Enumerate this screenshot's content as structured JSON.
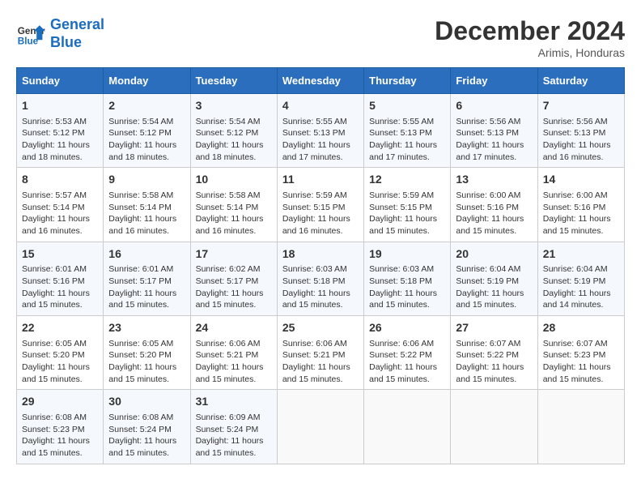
{
  "header": {
    "logo_line1": "General",
    "logo_line2": "Blue",
    "month": "December 2024",
    "location": "Arimis, Honduras"
  },
  "days_of_week": [
    "Sunday",
    "Monday",
    "Tuesday",
    "Wednesday",
    "Thursday",
    "Friday",
    "Saturday"
  ],
  "weeks": [
    [
      {
        "day": "1",
        "sunrise": "Sunrise: 5:53 AM",
        "sunset": "Sunset: 5:12 PM",
        "daylight": "Daylight: 11 hours and 18 minutes."
      },
      {
        "day": "2",
        "sunrise": "Sunrise: 5:54 AM",
        "sunset": "Sunset: 5:12 PM",
        "daylight": "Daylight: 11 hours and 18 minutes."
      },
      {
        "day": "3",
        "sunrise": "Sunrise: 5:54 AM",
        "sunset": "Sunset: 5:12 PM",
        "daylight": "Daylight: 11 hours and 18 minutes."
      },
      {
        "day": "4",
        "sunrise": "Sunrise: 5:55 AM",
        "sunset": "Sunset: 5:13 PM",
        "daylight": "Daylight: 11 hours and 17 minutes."
      },
      {
        "day": "5",
        "sunrise": "Sunrise: 5:55 AM",
        "sunset": "Sunset: 5:13 PM",
        "daylight": "Daylight: 11 hours and 17 minutes."
      },
      {
        "day": "6",
        "sunrise": "Sunrise: 5:56 AM",
        "sunset": "Sunset: 5:13 PM",
        "daylight": "Daylight: 11 hours and 17 minutes."
      },
      {
        "day": "7",
        "sunrise": "Sunrise: 5:56 AM",
        "sunset": "Sunset: 5:13 PM",
        "daylight": "Daylight: 11 hours and 16 minutes."
      }
    ],
    [
      {
        "day": "8",
        "sunrise": "Sunrise: 5:57 AM",
        "sunset": "Sunset: 5:14 PM",
        "daylight": "Daylight: 11 hours and 16 minutes."
      },
      {
        "day": "9",
        "sunrise": "Sunrise: 5:58 AM",
        "sunset": "Sunset: 5:14 PM",
        "daylight": "Daylight: 11 hours and 16 minutes."
      },
      {
        "day": "10",
        "sunrise": "Sunrise: 5:58 AM",
        "sunset": "Sunset: 5:14 PM",
        "daylight": "Daylight: 11 hours and 16 minutes."
      },
      {
        "day": "11",
        "sunrise": "Sunrise: 5:59 AM",
        "sunset": "Sunset: 5:15 PM",
        "daylight": "Daylight: 11 hours and 16 minutes."
      },
      {
        "day": "12",
        "sunrise": "Sunrise: 5:59 AM",
        "sunset": "Sunset: 5:15 PM",
        "daylight": "Daylight: 11 hours and 15 minutes."
      },
      {
        "day": "13",
        "sunrise": "Sunrise: 6:00 AM",
        "sunset": "Sunset: 5:16 PM",
        "daylight": "Daylight: 11 hours and 15 minutes."
      },
      {
        "day": "14",
        "sunrise": "Sunrise: 6:00 AM",
        "sunset": "Sunset: 5:16 PM",
        "daylight": "Daylight: 11 hours and 15 minutes."
      }
    ],
    [
      {
        "day": "15",
        "sunrise": "Sunrise: 6:01 AM",
        "sunset": "Sunset: 5:16 PM",
        "daylight": "Daylight: 11 hours and 15 minutes."
      },
      {
        "day": "16",
        "sunrise": "Sunrise: 6:01 AM",
        "sunset": "Sunset: 5:17 PM",
        "daylight": "Daylight: 11 hours and 15 minutes."
      },
      {
        "day": "17",
        "sunrise": "Sunrise: 6:02 AM",
        "sunset": "Sunset: 5:17 PM",
        "daylight": "Daylight: 11 hours and 15 minutes."
      },
      {
        "day": "18",
        "sunrise": "Sunrise: 6:03 AM",
        "sunset": "Sunset: 5:18 PM",
        "daylight": "Daylight: 11 hours and 15 minutes."
      },
      {
        "day": "19",
        "sunrise": "Sunrise: 6:03 AM",
        "sunset": "Sunset: 5:18 PM",
        "daylight": "Daylight: 11 hours and 15 minutes."
      },
      {
        "day": "20",
        "sunrise": "Sunrise: 6:04 AM",
        "sunset": "Sunset: 5:19 PM",
        "daylight": "Daylight: 11 hours and 15 minutes."
      },
      {
        "day": "21",
        "sunrise": "Sunrise: 6:04 AM",
        "sunset": "Sunset: 5:19 PM",
        "daylight": "Daylight: 11 hours and 14 minutes."
      }
    ],
    [
      {
        "day": "22",
        "sunrise": "Sunrise: 6:05 AM",
        "sunset": "Sunset: 5:20 PM",
        "daylight": "Daylight: 11 hours and 15 minutes."
      },
      {
        "day": "23",
        "sunrise": "Sunrise: 6:05 AM",
        "sunset": "Sunset: 5:20 PM",
        "daylight": "Daylight: 11 hours and 15 minutes."
      },
      {
        "day": "24",
        "sunrise": "Sunrise: 6:06 AM",
        "sunset": "Sunset: 5:21 PM",
        "daylight": "Daylight: 11 hours and 15 minutes."
      },
      {
        "day": "25",
        "sunrise": "Sunrise: 6:06 AM",
        "sunset": "Sunset: 5:21 PM",
        "daylight": "Daylight: 11 hours and 15 minutes."
      },
      {
        "day": "26",
        "sunrise": "Sunrise: 6:06 AM",
        "sunset": "Sunset: 5:22 PM",
        "daylight": "Daylight: 11 hours and 15 minutes."
      },
      {
        "day": "27",
        "sunrise": "Sunrise: 6:07 AM",
        "sunset": "Sunset: 5:22 PM",
        "daylight": "Daylight: 11 hours and 15 minutes."
      },
      {
        "day": "28",
        "sunrise": "Sunrise: 6:07 AM",
        "sunset": "Sunset: 5:23 PM",
        "daylight": "Daylight: 11 hours and 15 minutes."
      }
    ],
    [
      {
        "day": "29",
        "sunrise": "Sunrise: 6:08 AM",
        "sunset": "Sunset: 5:23 PM",
        "daylight": "Daylight: 11 hours and 15 minutes."
      },
      {
        "day": "30",
        "sunrise": "Sunrise: 6:08 AM",
        "sunset": "Sunset: 5:24 PM",
        "daylight": "Daylight: 11 hours and 15 minutes."
      },
      {
        "day": "31",
        "sunrise": "Sunrise: 6:09 AM",
        "sunset": "Sunset: 5:24 PM",
        "daylight": "Daylight: 11 hours and 15 minutes."
      },
      null,
      null,
      null,
      null
    ]
  ]
}
